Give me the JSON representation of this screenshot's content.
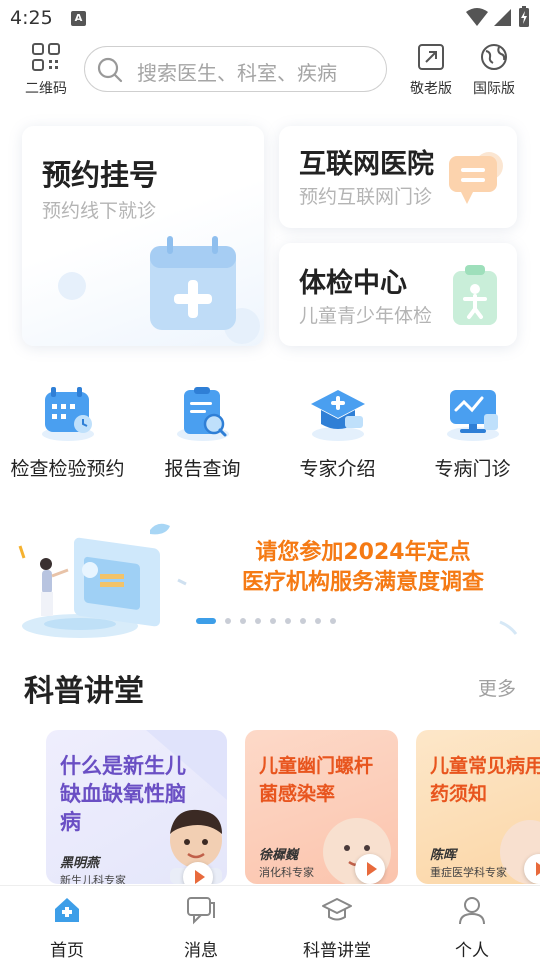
{
  "status_bar": {
    "time": "4:25",
    "notif_letter": "A"
  },
  "header": {
    "qr_label": "二维码",
    "search_placeholder": "搜索医生、科室、疾病",
    "elder_label": "敬老版",
    "intl_label": "国际版"
  },
  "cards": {
    "appointment": {
      "title": "预约挂号",
      "subtitle": "预约线下就诊"
    },
    "internet_hospital": {
      "title": "互联网医院",
      "subtitle": "预约互联网门诊"
    },
    "checkup": {
      "title": "体检中心",
      "subtitle": "儿童青少年体检"
    }
  },
  "services": [
    {
      "label": "检查检验预约",
      "icon": "calendar-clock-icon"
    },
    {
      "label": "报告查询",
      "icon": "report-search-icon"
    },
    {
      "label": "专家介绍",
      "icon": "expert-cap-icon"
    },
    {
      "label": "专病门诊",
      "icon": "clinic-monitor-icon"
    }
  ],
  "banner": {
    "line1": "请您参加2024年定点",
    "line2": "医疗机构服务满意度调查",
    "active_index": 0,
    "dot_count": 9
  },
  "lectures_section": {
    "title": "科普讲堂",
    "more": "更多"
  },
  "lectures": [
    {
      "title": "什么是新生儿缺血缺氧性脑病",
      "doctor": "黑明燕",
      "dept": "新生儿科专家"
    },
    {
      "title": "儿童幽门螺杆菌感染率",
      "doctor": "徐樨巍",
      "dept": "消化科专家"
    },
    {
      "title": "儿童常见病用药须知",
      "doctor": "陈晖",
      "dept": "重症医学科专家"
    }
  ],
  "tabbar": [
    {
      "label": "首页",
      "icon": "home-icon",
      "active": true
    },
    {
      "label": "消息",
      "icon": "message-icon",
      "active": false
    },
    {
      "label": "科普讲堂",
      "icon": "graduation-cap-icon",
      "active": false
    },
    {
      "label": "个人",
      "icon": "person-icon",
      "active": false
    }
  ],
  "colors": {
    "accent": "#3d9ee8",
    "banner_text": "#f57a14",
    "lecture_purple": "#6a4fc4",
    "lecture_orange": "#e8551e"
  }
}
